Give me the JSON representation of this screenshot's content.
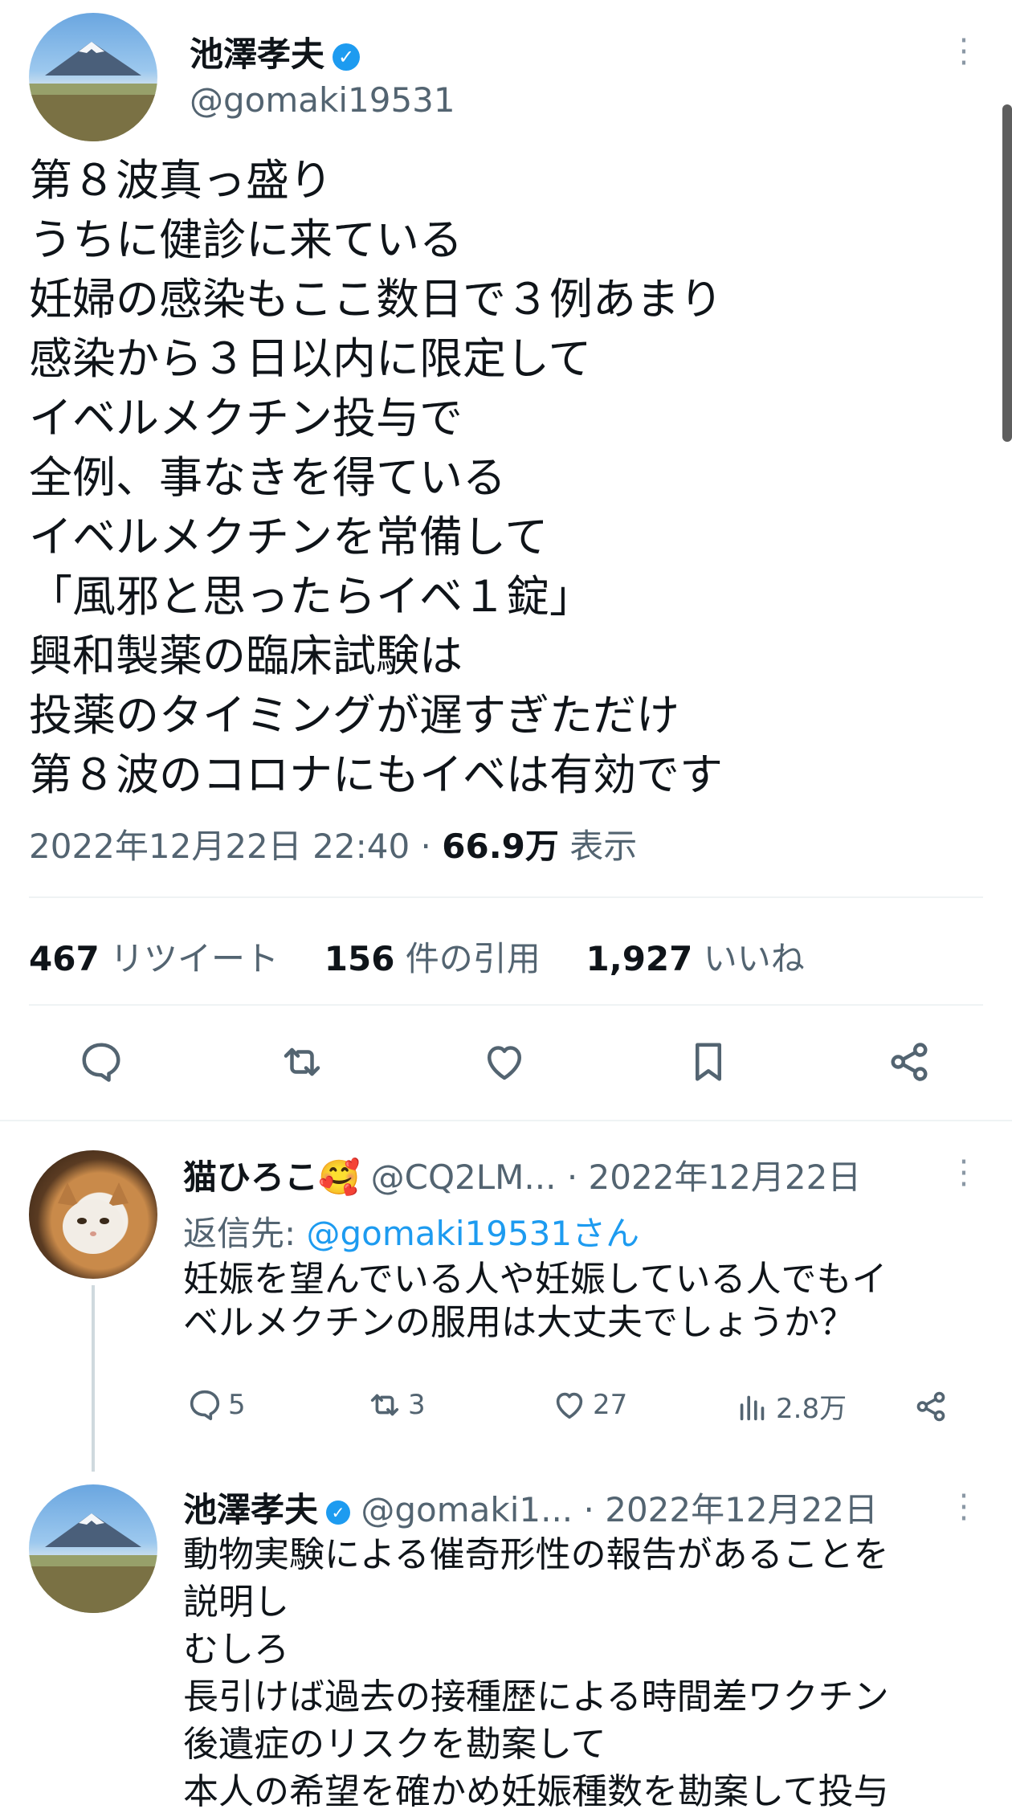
{
  "main_tweet": {
    "author_name": "池澤孝夫",
    "handle": "@gomaki19531",
    "lines": [
      "第８波真っ盛り",
      "うちに健診に来ている",
      "妊婦の感染もここ数日で３例あまり",
      "感染から３日以内に限定して",
      "イベルメクチン投与で",
      "全例、事なきを得ている",
      "イベルメクチンを常備して",
      "「風邪と思ったらイベ１錠」",
      "興和製薬の臨床試験は",
      "投薬のタイミングが遅すぎただけ",
      "第８波のコロナにもイベは有効です"
    ],
    "timestamp": "2022年12月22日 22:40",
    "separator": "·",
    "views_count": "66.9万",
    "views_label": "表示",
    "retweets_count": "467",
    "retweets_label": "リツイート",
    "quotes_count": "156",
    "quotes_label": "件の引用",
    "likes_count": "1,927",
    "likes_label": "いいね"
  },
  "action_icons": [
    "reply-icon",
    "retweet-icon",
    "like-icon",
    "bookmark-icon",
    "share-icon"
  ],
  "reply1": {
    "author_name": "猫ひろこ",
    "emoji": "🥰",
    "handle": "@CQ2LM...",
    "date": "· 2022年12月22日",
    "reply_to_label": "返信先: ",
    "reply_to_handle": "@gomaki19531さん",
    "lines": [
      "妊娠を望んでいる人や妊娠している人でもイ",
      "ベルメクチンの服用は大丈夫でしょうか？"
    ],
    "replies": "5",
    "retweets": "3",
    "likes": "27",
    "views": "2.8万"
  },
  "reply2": {
    "author_name": "池澤孝夫",
    "handle": "@gomaki1...",
    "date": "· 2022年12月22日",
    "lines": [
      "動物実験による催奇形性の報告があることを",
      "説明し",
      "むしろ",
      "長引けば過去の接種歴による時間差ワクチン",
      "後遺症のリスクを勘案して",
      "本人の希望を確かめ妊娠種数を勘案して投与"
    ]
  },
  "colors": {
    "accent": "#1d9bf0",
    "text": "#0f1419",
    "muted": "#536471",
    "divider": "#eff3f4"
  }
}
